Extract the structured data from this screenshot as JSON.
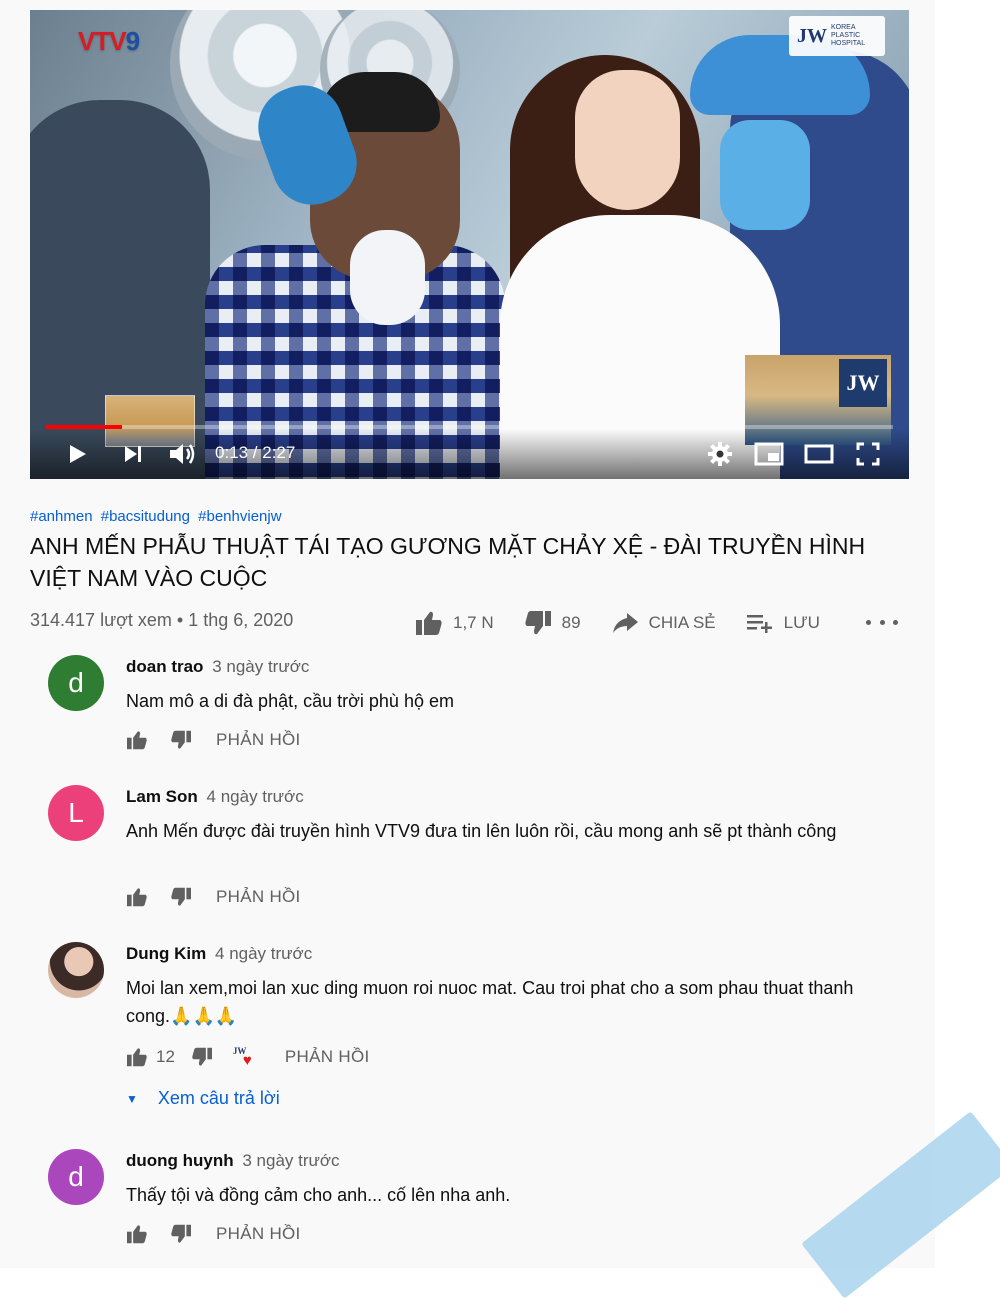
{
  "video": {
    "channel_logo": "VTV9",
    "badge_logo": "JW",
    "badge_sub": "KOREA PLASTIC HOSPITAL",
    "current_time": "0:13",
    "duration": "2:27",
    "time_display": "0:13 / 2:27",
    "progress_fraction": 0.09
  },
  "info": {
    "hashtags": [
      "#anhmen",
      "#bacsitudung",
      "#benhvienjw"
    ],
    "title": "ANH MẾN PHẪU THUẬT TÁI TẠO GƯƠNG MẶT CHẢY XỆ - ĐÀI TRUYỀN HÌNH VIỆT NAM VÀO CUỘC",
    "meta": "314.417 lượt xem • 1 thg 6, 2020",
    "likes": "1,7 N",
    "dislikes": "89",
    "share_label": "CHIA SẺ",
    "save_label": "LƯU"
  },
  "comments": [
    {
      "avatar_letter": "d",
      "avatar_color": "#2e7d32",
      "author": "doan trao",
      "time": "3 ngày trước",
      "text": "Nam mô a di đà phật, cầu trời phù hộ em",
      "reply_label": "PHẢN HỒI"
    },
    {
      "avatar_letter": "L",
      "avatar_color": "#ec407a",
      "author": "Lam Son",
      "time": "4 ngày trước",
      "text": "Anh Mến được đài truyền hình VTV9 đưa tin lên luôn rồi, cầu mong anh sẽ pt thành công",
      "reply_label": "PHẢN HỒI"
    },
    {
      "avatar_letter": "",
      "avatar_color": "",
      "author": "Dung Kim",
      "time": "4 ngày trước",
      "text": "Moi lan xem,moi lan xuc ding muon roi nuoc mat. Cau troi phat cho a som phau thuat thanh cong.🙏🙏🙏",
      "like_count": "12",
      "reply_label": "PHẢN HỒI",
      "view_replies": "Xem câu trả lời"
    },
    {
      "avatar_letter": "d",
      "avatar_color": "#ab47bc",
      "author": "duong huynh",
      "time": "3 ngày trước",
      "text": "Thấy tội và đồng cảm cho anh... cố lên nha anh.",
      "reply_label": "PHẢN HỒI"
    }
  ],
  "icons": {
    "play": "play-icon",
    "next": "next-icon",
    "volume": "volume-icon",
    "settings": "gear-icon",
    "miniplayer": "miniplayer-icon",
    "theater": "theater-icon",
    "fullscreen": "fullscreen-icon",
    "like": "thumbs-up-icon",
    "dislike": "thumbs-down-icon",
    "share": "share-icon",
    "save": "playlist-add-icon",
    "more": "more-icon"
  },
  "colors": {
    "accent_blue": "#065fd4",
    "progress_red": "#ff0000",
    "muted_text": "#606060"
  }
}
